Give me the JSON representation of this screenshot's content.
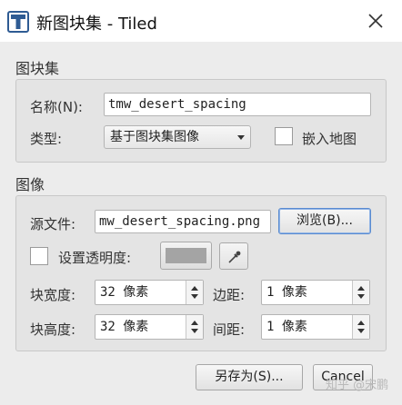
{
  "window": {
    "title": "新图块集 - Tiled"
  },
  "tileset_section": {
    "title": "图块集",
    "name_label": "名称(N):",
    "name_value": "tmw_desert_spacing",
    "type_label": "类型:",
    "type_value": "基于图块集图像",
    "embed_label": "嵌入地图"
  },
  "image_section": {
    "title": "图像",
    "source_label": "源文件:",
    "source_value": "mw_desert_spacing.png",
    "browse_label": "浏览(B)...",
    "transparency_label": "设置透明度:",
    "tile_width_label": "块宽度:",
    "tile_width_value": "32 像素",
    "margin_label": "边距:",
    "margin_value": "1 像素",
    "tile_height_label": "块高度:",
    "tile_height_value": "32 像素",
    "spacing_label": "间距:",
    "spacing_value": "1 像素"
  },
  "footer": {
    "save_as_label": "另存为(S)...",
    "cancel_label": "Cancel",
    "watermark": "知乎 @宋鹏"
  },
  "icons": {
    "app": "tiled-app-icon",
    "close": "close-icon",
    "picker": "eyedropper-icon"
  },
  "colors": {
    "transparency_swatch": "#a4a4a4",
    "focus": "#5a8bd0",
    "app_icon": "#2e5b93"
  }
}
